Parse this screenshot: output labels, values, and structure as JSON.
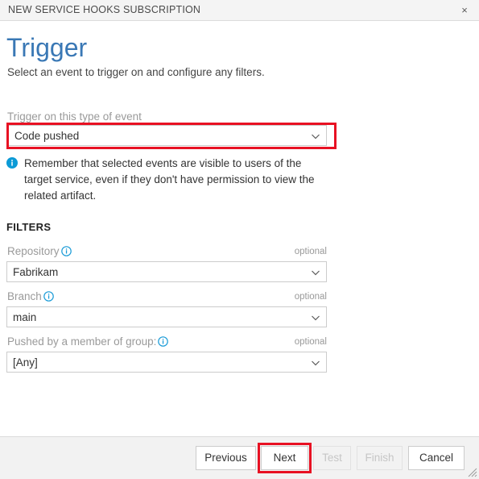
{
  "window": {
    "title": "NEW SERVICE HOOKS SUBSCRIPTION",
    "close_label": "×"
  },
  "page": {
    "title": "Trigger",
    "subtitle": "Select an event to trigger on and configure any filters."
  },
  "event": {
    "label": "Trigger on this type of event",
    "value": "Code pushed"
  },
  "info_message": {
    "icon": "info-circle-filled-icon",
    "text": "Remember that selected events are visible to users of the target service, even if they don't have permission to view the related artifact."
  },
  "filters": {
    "heading": "FILTERS",
    "optional_tag": "optional",
    "fields": [
      {
        "label": "Repository",
        "value": "Fabrikam",
        "optional": "optional",
        "info_icon": "info-circle-outline-icon"
      },
      {
        "label": "Branch",
        "value": "main",
        "optional": "optional",
        "info_icon": "info-circle-outline-icon"
      },
      {
        "label": "Pushed by a member of group:",
        "value": "[Any]",
        "optional": "optional",
        "info_icon": "info-circle-outline-icon"
      }
    ]
  },
  "footer": {
    "buttons": [
      {
        "label": "Previous",
        "disabled": false,
        "highlighted": false
      },
      {
        "label": "Next",
        "disabled": false,
        "highlighted": true
      },
      {
        "label": "Test",
        "disabled": true,
        "highlighted": false
      },
      {
        "label": "Finish",
        "disabled": true,
        "highlighted": false
      },
      {
        "label": "Cancel",
        "disabled": false,
        "highlighted": false
      }
    ]
  },
  "colors": {
    "accent_blue": "#3a78b5",
    "info_blue": "#0b9ad6",
    "highlight_red": "#e81123",
    "border_grey": "#cccccc",
    "footer_bg": "#f2f2f2"
  }
}
